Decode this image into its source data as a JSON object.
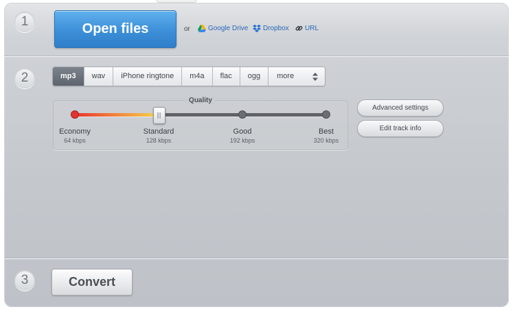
{
  "steps": [
    "1",
    "2",
    "3"
  ],
  "open_button": {
    "label": "Open files"
  },
  "sources": {
    "or_text": "or",
    "items": [
      {
        "label": "Google Drive",
        "icon": "google-drive-icon"
      },
      {
        "label": "Dropbox",
        "icon": "dropbox-icon"
      },
      {
        "label": "URL",
        "icon": "link-icon"
      }
    ]
  },
  "formats": {
    "items": [
      "mp3",
      "wav",
      "iPhone ringtone",
      "m4a",
      "flac",
      "ogg",
      "more"
    ],
    "selected": "mp3"
  },
  "quality": {
    "title": "Quality",
    "selected_index": 1,
    "levels": [
      {
        "name": "Economy",
        "rate": "64 kbps"
      },
      {
        "name": "Standard",
        "rate": "128 kbps"
      },
      {
        "name": "Good",
        "rate": "192 kbps"
      },
      {
        "name": "Best",
        "rate": "320 kbps"
      }
    ]
  },
  "side_buttons": {
    "advanced": "Advanced settings",
    "track_info": "Edit track info"
  },
  "convert_button": {
    "label": "Convert"
  },
  "colors": {
    "accent_blue": "#3d8fd8",
    "link_blue": "#2a66b8",
    "slider_red": "#e2342f"
  }
}
